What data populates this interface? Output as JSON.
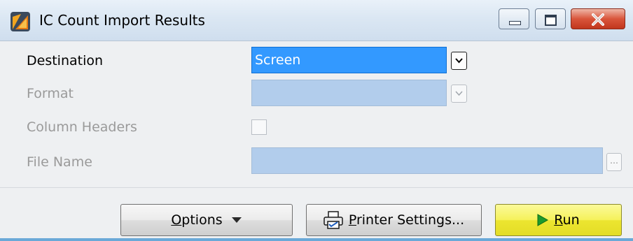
{
  "window": {
    "title": "IC Count Import Results",
    "icon": "app-icon"
  },
  "form": {
    "destination": {
      "label": "Destination",
      "value": "Screen"
    },
    "format": {
      "label": "Format",
      "value": ""
    },
    "column_headers": {
      "label": "Column Headers",
      "checked": false
    },
    "file_name": {
      "label": "File Name",
      "value": ""
    }
  },
  "buttons": {
    "options": {
      "mnemonic": "O",
      "rest": "ptions"
    },
    "printer_settings": {
      "mnemonic": "P",
      "rest": "rinter Settings..."
    },
    "run": {
      "mnemonic": "R",
      "rest": "un"
    }
  },
  "colors": {
    "selected_field": "#3399ff",
    "disabled_field": "#b2cdec",
    "run_button": "#f5f15a",
    "close_button": "#d9553b"
  }
}
